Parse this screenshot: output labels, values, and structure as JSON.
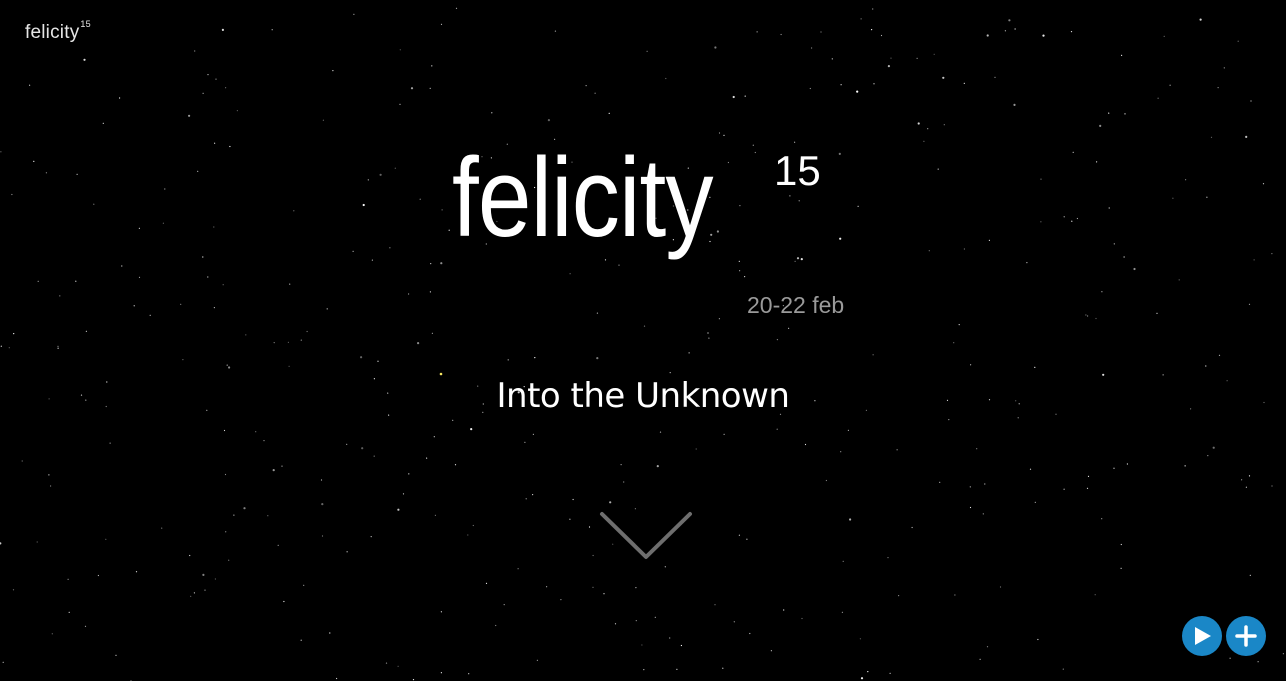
{
  "header": {
    "logo_text": "felicity",
    "logo_superscript": "15"
  },
  "hero": {
    "title": "felicity",
    "title_number": "15",
    "dates": "20-22 feb",
    "tagline": "Into the Unknown"
  },
  "controls": {
    "scroll_icon": "chevron-down-icon",
    "play_icon": "play-icon",
    "plus_icon": "plus-icon"
  },
  "colors": {
    "background": "#000000",
    "accent": "#1a87c7",
    "dates": "#9a9a9a",
    "chevron": "#6e6e6e"
  }
}
